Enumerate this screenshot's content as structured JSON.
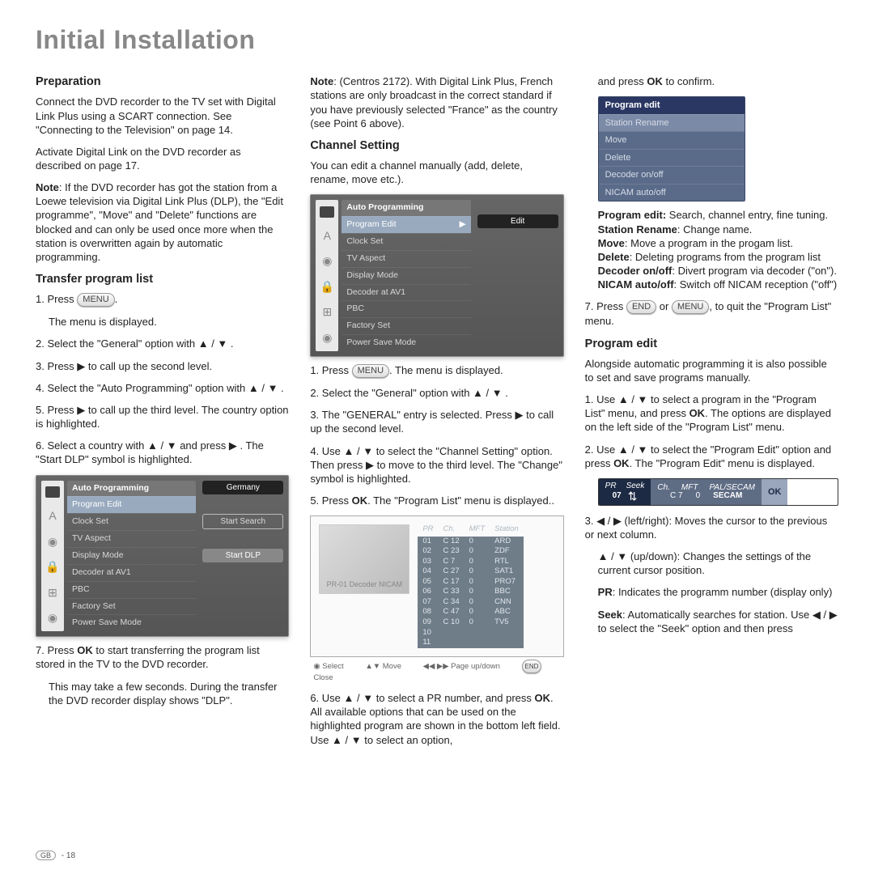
{
  "title": "Initial Installation",
  "col1": {
    "prep_h": "Preparation",
    "prep_p1": "Connect the DVD recorder to the TV set with Digital Link Plus using a SCART connection. See \"Connecting to the Television\" on page 14.",
    "prep_p2": "Activate Digital Link on the DVD recorder as described on page 17.",
    "note_b": "Note",
    "note_t": ": If the DVD recorder has got the station from a Loewe television via Digital Link Plus (DLP), the \"Edit programme\", \"Move\" and \"Delete\" functions are blocked and can only be used once more when the station is overwritten again by automatic programming.",
    "tpl_h": "Transfer program list",
    "s1a": "1. Press ",
    "s1btn": "MENU",
    "s1b": ".",
    "s1c": "The menu is displayed.",
    "s2": "2. Select the \"General\" option with ▲ / ▼ .",
    "s3": "3. Press  ▶  to call up the second level.",
    "s4": "4. Select the \"Auto Programming\" option with ▲ / ▼ .",
    "s5": "5. Press  ▶  to call up the third level. The country option is highlighted.",
    "s6": "6. Select a country with ▲ / ▼ and press  ▶ . The \"Start DLP\" symbol is highlighted.",
    "menu": {
      "hd": "Auto Programming",
      "rows": [
        "Program Edit",
        "Clock Set",
        "TV Aspect",
        "Display Mode",
        "Decoder at AV1",
        "PBC",
        "Factory Set",
        "Power Save Mode"
      ],
      "tags": [
        "Germany",
        "Start Search",
        "Start DLP"
      ]
    },
    "s7a": "7. Press ",
    "s7ok": "OK",
    "s7b": " to start transferring the program list stored in the TV to the DVD recorder.",
    "s7c": "This may take a few seconds. During the transfer the DVD recorder display shows \"DLP\"."
  },
  "col2": {
    "note_b": "Note",
    "note_t": ": (Centros 2172). With Digital Link Plus, French stations are only broadcast in the correct standard if you have previously selected \"France\" as the country (see Point 6 above).",
    "cs_h": "Channel Setting",
    "cs_p": "You can edit a channel manually (add, delete, rename, move etc.).",
    "menu": {
      "hd": "Auto Programming",
      "rows": [
        "Program Edit",
        "Clock Set",
        "TV Aspect",
        "Display Mode",
        "Decoder at AV1",
        "PBC",
        "Factory Set",
        "Power Save Mode"
      ],
      "edit": "Edit"
    },
    "s1a": "1. Press ",
    "s1btn": "MENU",
    "s1b": ". The menu is displayed.",
    "s2": "2. Select the \"General\" option with ▲ / ▼ .",
    "s3": "3. The \"GENERAL\" entry is selected. Press  ▶  to call up the second level.",
    "s4": "4. Use ▲ / ▼ to select the \"Channel Setting\" option. Then press  ▶  to move to the third level. The \"Change\" symbol is highlighted.",
    "s5a": "5. Press ",
    "s5ok": "OK",
    "s5b": ". The \"Program List\" menu is displayed..",
    "plist": {
      "thumb": "PR-01  Decoder  NICAM",
      "head": [
        "PR",
        "Ch.",
        "MFT",
        "Station"
      ],
      "rows": [
        [
          "01",
          "C 12",
          "0",
          "ARD"
        ],
        [
          "02",
          "C 23",
          "0",
          "ZDF"
        ],
        [
          "03",
          "C 7",
          "0",
          "RTL"
        ],
        [
          "04",
          "C 27",
          "0",
          "SAT1"
        ],
        [
          "05",
          "C 17",
          "0",
          "PRO7"
        ],
        [
          "06",
          "C 33",
          "0",
          "BBC"
        ],
        [
          "07",
          "C 34",
          "0",
          "CNN"
        ],
        [
          "08",
          "C 47",
          "0",
          "ABC"
        ],
        [
          "09",
          "C 10",
          "0",
          "TV5"
        ],
        [
          "10",
          "",
          "",
          ""
        ],
        [
          "11",
          "",
          "",
          ""
        ]
      ],
      "legend": [
        "Select",
        "Move",
        "Page up/down",
        "Close"
      ]
    },
    "s6a": "6. Use ▲ / ▼ to select a PR number, and press ",
    "s6ok": "OK",
    "s6b": ". All available options that can be used on the highlighted program are shown in the bottom left field. Use ▲ / ▼ to select an option,"
  },
  "col3": {
    "top_a": "and press ",
    "top_ok": "OK",
    "top_b": " to confirm.",
    "tbl": {
      "th": "Program edit",
      "rows": [
        "Station Rename",
        "Move",
        "Delete",
        "Decoder on/off",
        "NICAM auto/off"
      ]
    },
    "def_pe_b": "Program edit:",
    "def_pe_t": " Search, channel entry, fine tuning.",
    "def_sr_b": "Station Rename",
    "def_sr_t": ": Change name.",
    "def_mv_b": "Move",
    "def_mv_t": ": Move a program in the progam list.",
    "def_dl_b": "Delete",
    "def_dl_t": ": Deleting programs from the program list",
    "def_dc_b": "Decoder on/off",
    "def_dc_t": ": Divert program via decoder (\"on\").",
    "def_nc_b": "NICAM auto/off",
    "def_nc_t": ": Switch off NICAM reception (\"off\")",
    "s7a": "7. Press ",
    "s7end": "END",
    "s7or": " or ",
    "s7menu": "MENU",
    "s7b": ", to quit the \"Program List\" menu.",
    "pe_h": "Program edit",
    "pe_p": "Alongside automatic programming it is also possible to set and save programs manually.",
    "s1a": "1. Use ▲ / ▼ to select a program in the \"Program List\" menu, and press ",
    "s1ok": "OK",
    "s1b": ". The options are displayed on the left side of the \"Program List\" menu.",
    "s2a": "2. Use ▲ / ▼ to select the \"Program Edit\" option and press ",
    "s2ok": "OK",
    "s2b": ". The \"Program Edit\" menu is displayed.",
    "bar": {
      "pr": "PR",
      "seek": "Seek",
      "ch": "Ch.",
      "mft": "MFT",
      "std_h": "PAL/SECAM",
      "num": "07",
      "chv": "C 7",
      "mftv": "0",
      "std": "SECAM",
      "ok": "OK"
    },
    "s3": "3.  ◀ / ▶  (left/right): Moves the cursor to the previous or next column.",
    "s3b": "▲ / ▼ (up/down): Changes the settings of the current cursor position.",
    "def_pr_b": "PR",
    "def_pr_t": ": Indicates the programm number (display only)",
    "def_sk_b": "Seek",
    "def_sk_t": ": Automatically searches for station. Use  ◀ / ▶  to select the \"Seek\" option and then press"
  },
  "footer": {
    "gb": "GB",
    "pg": "- 18"
  }
}
